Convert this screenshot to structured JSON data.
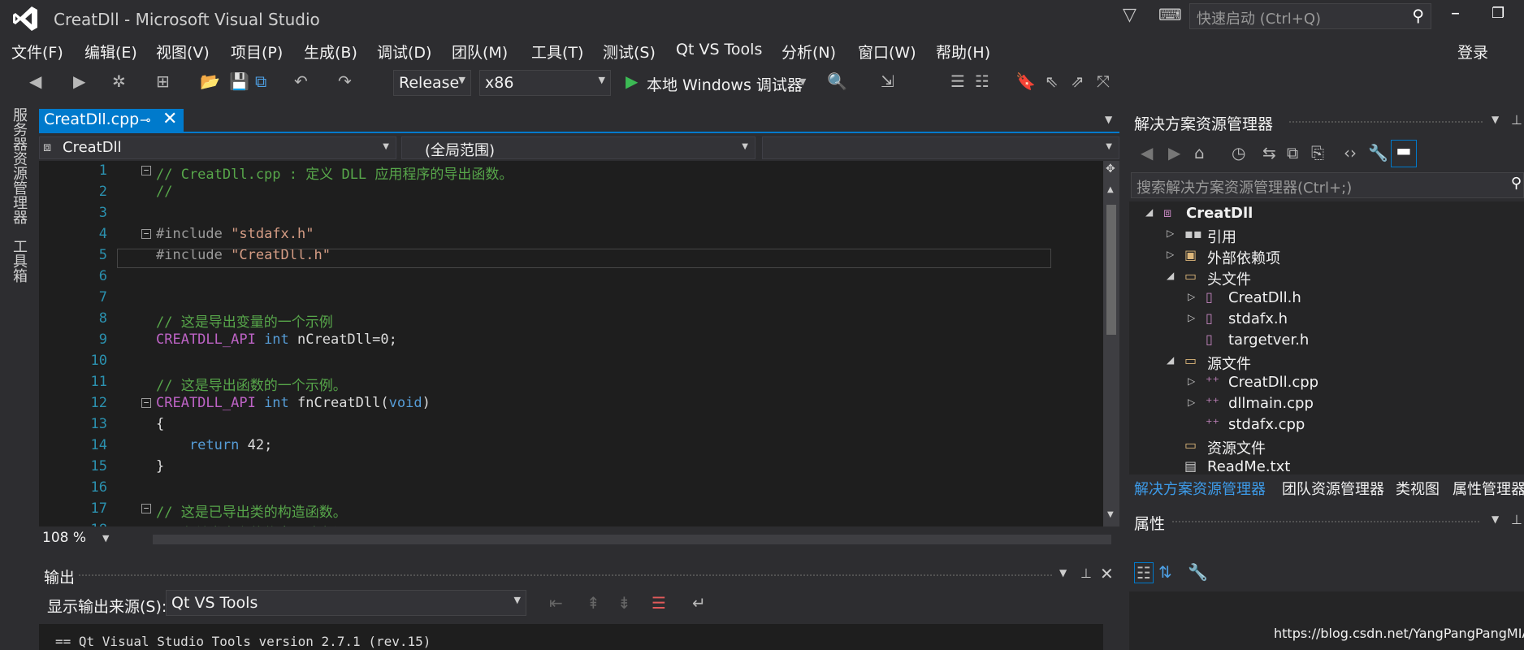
{
  "window": {
    "title": "CreatDll - Microsoft Visual Studio",
    "quick_launch_placeholder": "快速启动 (Ctrl+Q)",
    "signin": "登录"
  },
  "menu": [
    "文件(F)",
    "编辑(E)",
    "视图(V)",
    "项目(P)",
    "生成(B)",
    "调试(D)",
    "团队(M)",
    "工具(T)",
    "测试(S)",
    "Qt VS Tools",
    "分析(N)",
    "窗口(W)",
    "帮助(H)"
  ],
  "toolbar": {
    "configuration": "Release",
    "platform": "x86",
    "debugger": "本地 Windows 调试器"
  },
  "side_tabs": [
    "服务器资源管理器",
    "工具箱"
  ],
  "editor": {
    "tab_label": "CreatDll.cpp",
    "nav_project": "CreatDll",
    "nav_scope": "(全局范围)",
    "nav_member": "",
    "zoom": "108 %",
    "lines": [
      {
        "n": "1",
        "parts": [
          [
            "c-com",
            "// CreatDll.cpp : 定义 DLL 应用程序的导出函数。"
          ]
        ],
        "fold": "−"
      },
      {
        "n": "2",
        "parts": [
          [
            "c-com",
            "//"
          ]
        ]
      },
      {
        "n": "3",
        "parts": []
      },
      {
        "n": "4",
        "parts": [
          [
            "c-pp",
            "#include "
          ],
          [
            "c-str",
            "\"stdafx.h\""
          ]
        ],
        "fold": "−"
      },
      {
        "n": "5",
        "parts": [
          [
            "c-pp",
            "#include "
          ],
          [
            "c-str",
            "\"CreatDll.h\""
          ]
        ]
      },
      {
        "n": "6",
        "parts": []
      },
      {
        "n": "7",
        "parts": []
      },
      {
        "n": "8",
        "parts": [
          [
            "c-com",
            "// 这是导出变量的一个示例"
          ]
        ]
      },
      {
        "n": "9",
        "parts": [
          [
            "c-mac",
            "CREATDLL_API "
          ],
          [
            "c-kw",
            "int"
          ],
          [
            "c-def",
            " nCreatDll=0;"
          ]
        ]
      },
      {
        "n": "10",
        "parts": []
      },
      {
        "n": "11",
        "parts": [
          [
            "c-com",
            "// 这是导出函数的一个示例。"
          ]
        ]
      },
      {
        "n": "12",
        "parts": [
          [
            "c-mac",
            "CREATDLL_API "
          ],
          [
            "c-kw",
            "int"
          ],
          [
            "c-def",
            " fnCreatDll("
          ],
          [
            "c-kw",
            "void"
          ],
          [
            "c-def",
            ")"
          ]
        ],
        "fold": "−"
      },
      {
        "n": "13",
        "parts": [
          [
            "c-def",
            "{"
          ]
        ]
      },
      {
        "n": "14",
        "parts": [
          [
            "c-kw",
            "    return"
          ],
          [
            "c-def",
            " 42;"
          ]
        ]
      },
      {
        "n": "15",
        "parts": [
          [
            "c-def",
            "}"
          ]
        ]
      },
      {
        "n": "16",
        "parts": []
      },
      {
        "n": "17",
        "parts": [
          [
            "c-com",
            "// 这是已导出类的构造函数。"
          ]
        ],
        "fold": "−"
      },
      {
        "n": "18",
        "parts": [
          [
            "c-com",
            "// 有关类定义的信息，请参阅 CreatDll.h"
          ]
        ]
      }
    ]
  },
  "output": {
    "title": "输出",
    "source_label": "显示输出来源(S):",
    "source_value": "Qt VS Tools",
    "text": "== Qt Visual Studio Tools version 2.7.1 (rev.15)"
  },
  "solution_explorer": {
    "title": "解决方案资源管理器",
    "search_placeholder": "搜索解决方案资源管理器(Ctrl+;)",
    "tree": [
      {
        "label": "CreatDll",
        "level": 0,
        "exp": "◢",
        "icon": "project-icon",
        "bold": true
      },
      {
        "label": "引用",
        "level": 1,
        "exp": "▷",
        "icon": "references-icon"
      },
      {
        "label": "外部依赖项",
        "level": 1,
        "exp": "▷",
        "icon": "external-deps-icon"
      },
      {
        "label": "头文件",
        "level": 1,
        "exp": "◢",
        "icon": "folder-icon"
      },
      {
        "label": "CreatDll.h",
        "level": 2,
        "exp": "▷",
        "icon": "header-file-icon"
      },
      {
        "label": "stdafx.h",
        "level": 2,
        "exp": "▷",
        "icon": "header-file-icon"
      },
      {
        "label": "targetver.h",
        "level": 2,
        "exp": "",
        "icon": "header-file-icon"
      },
      {
        "label": "源文件",
        "level": 1,
        "exp": "◢",
        "icon": "folder-icon"
      },
      {
        "label": "CreatDll.cpp",
        "level": 2,
        "exp": "▷",
        "icon": "cpp-file-icon"
      },
      {
        "label": "dllmain.cpp",
        "level": 2,
        "exp": "▷",
        "icon": "cpp-file-icon"
      },
      {
        "label": "stdafx.cpp",
        "level": 2,
        "exp": "",
        "icon": "cpp-file-icon"
      },
      {
        "label": "资源文件",
        "level": 1,
        "exp": "",
        "icon": "folder-icon"
      },
      {
        "label": "ReadMe.txt",
        "level": 1,
        "exp": "",
        "icon": "text-file-icon"
      }
    ],
    "tabs": [
      "解决方案资源管理器",
      "团队资源管理器",
      "类视图",
      "属性管理器"
    ]
  },
  "properties": {
    "title": "属性"
  },
  "watermark": "https://blog.csdn.net/YangPangPangMIAO",
  "colors": {
    "accent": "#007acc",
    "comment": "#57a64a",
    "keyword": "#569cd6",
    "macro": "#bd63c5",
    "string": "#d69d85"
  }
}
